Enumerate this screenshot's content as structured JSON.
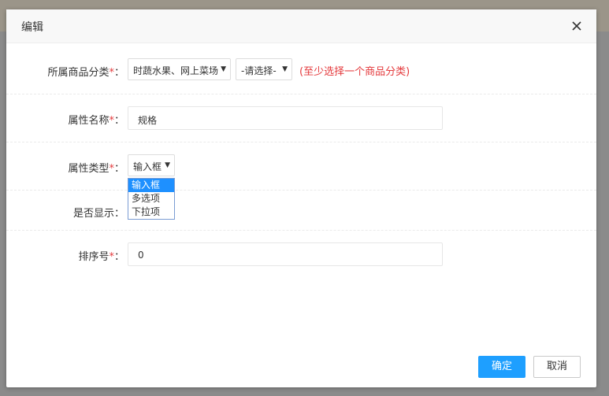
{
  "dialog": {
    "title": "编辑",
    "close_icon": "close-icon"
  },
  "form": {
    "category": {
      "label": "所属商品分类",
      "required_mark": "*",
      "colon": "：",
      "select1_value": "时蔬水果、网上菜场",
      "select2_value": "-请选择-",
      "hint": "(至少选择一个商品分类)"
    },
    "attr_name": {
      "label": "属性名称",
      "required_mark": "*",
      "colon": "：",
      "value": "规格"
    },
    "attr_type": {
      "label": "属性类型",
      "required_mark": "*",
      "colon": "：",
      "selected": "输入框",
      "options": [
        "输入框",
        "多选项",
        "下拉项"
      ]
    },
    "display": {
      "label": "是否显示",
      "colon": "："
    },
    "sort": {
      "label": "排序号",
      "required_mark": "*",
      "colon": "：",
      "value": "0"
    }
  },
  "footer": {
    "confirm_label": "确定",
    "cancel_label": "取消"
  },
  "colors": {
    "primary": "#1e9fff",
    "required": "#e4393c",
    "selected_option": "#1e90ff"
  }
}
